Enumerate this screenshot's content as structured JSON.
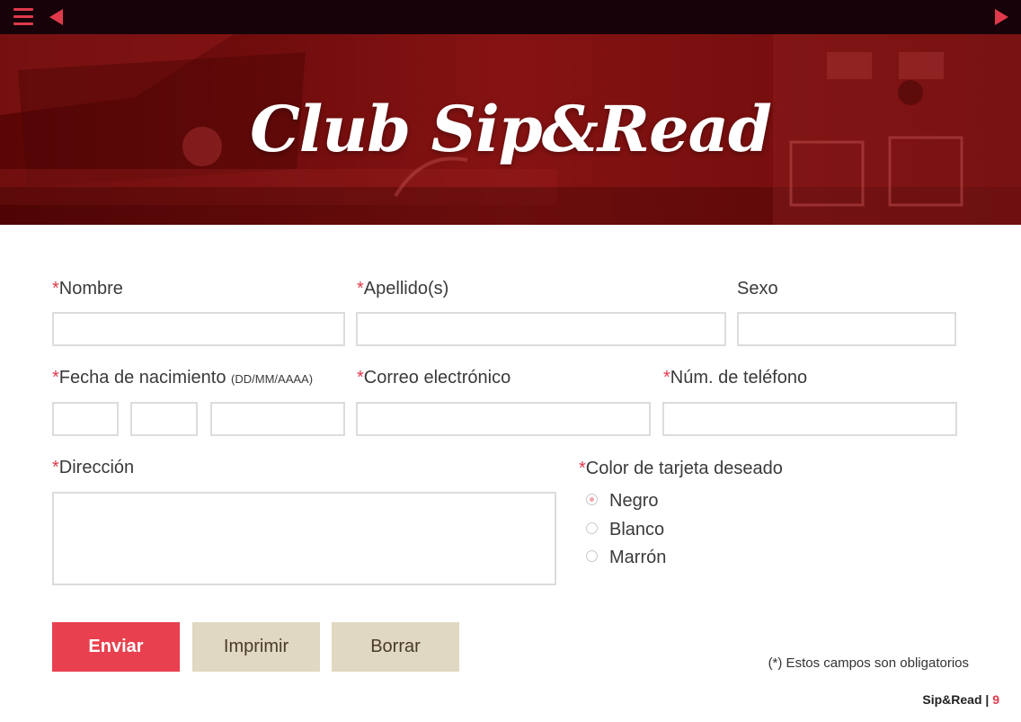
{
  "header": {
    "title": "Club Sip&Read"
  },
  "form": {
    "nombre": {
      "label": "Nombre",
      "value": ""
    },
    "apellidos": {
      "label": "Apellido(s)",
      "value": ""
    },
    "sexo": {
      "label": "Sexo",
      "value": ""
    },
    "fecha": {
      "label": "Fecha de nacimiento ",
      "hint": "(DD/MM/AAAA)",
      "day": "",
      "month": "",
      "year": ""
    },
    "correo": {
      "label": "Correo electrónico",
      "value": ""
    },
    "telefono": {
      "label": "Núm. de teléfono",
      "value": ""
    },
    "direccion": {
      "label": "Dirección",
      "value": ""
    },
    "color": {
      "label": "Color de tarjeta deseado",
      "options": [
        "Negro",
        "Blanco",
        "Marrón"
      ],
      "selected": "Negro"
    },
    "required_mark": "*"
  },
  "buttons": {
    "submit": "Enviar",
    "print": "Imprimir",
    "clear": "Borrar"
  },
  "note": "(*) Estos campos son obligatorios",
  "footer": {
    "brand": "Sip&Read",
    "separator": " | ",
    "page": "9"
  },
  "colors": {
    "accent": "#e0394b",
    "topbar": "#160208",
    "hero": "#7c0f0f",
    "secondary_button": "#e0d8c0"
  },
  "icons": {
    "menu": "hamburger-icon",
    "prev": "triangle-left-icon",
    "next": "triangle-right-icon"
  }
}
